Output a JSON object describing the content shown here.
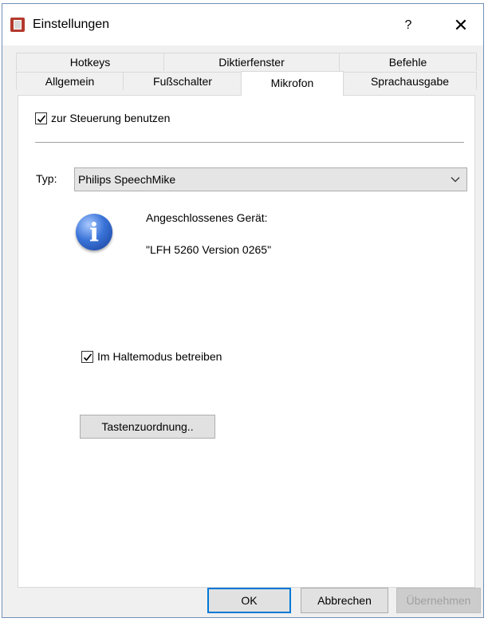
{
  "window": {
    "title": "Einstellungen",
    "help_glyph": "?",
    "close_glyph": "✕",
    "icon": "app-icon"
  },
  "tabs": {
    "row1": [
      "Hotkeys",
      "Diktierfenster",
      "Befehle"
    ],
    "row2": [
      "Allgemein",
      "Fußschalter",
      "Mikrofon",
      "Sprachausgabe"
    ],
    "active": "Mikrofon"
  },
  "mikrofon": {
    "use_for_control": {
      "label": "zur Steuerung benutzen",
      "checked": true
    },
    "type_label": "Typ:",
    "type_value": "Philips SpeechMike",
    "device_heading": "Angeschlossenes Gerät:",
    "device_name": "\"LFH 5260 Version 0265\"",
    "hold_mode": {
      "label": "Im Haltemodus betreiben",
      "checked": true
    },
    "key_mapping_button": "Tastenzuordnung.."
  },
  "buttons": {
    "ok": "OK",
    "cancel": "Abbrechen",
    "apply": "Übernehmen"
  },
  "colors": {
    "accent": "#0078d7",
    "info_icon": "#2f6bd0",
    "app_icon": "#b33a2d"
  }
}
